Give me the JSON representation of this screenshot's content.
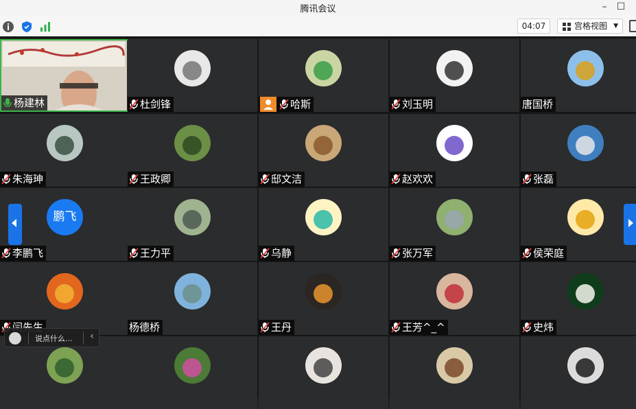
{
  "window": {
    "title": "腾讯会议"
  },
  "toolbar": {
    "icons": [
      "info-icon",
      "shield-icon",
      "signal-icon"
    ],
    "timer": "04:07",
    "view_label": "宫格视图"
  },
  "participants": [
    {
      "name": "杨建林",
      "muted": false,
      "speaking": true,
      "avatar": "video"
    },
    {
      "name": "杜剑锋",
      "muted": true,
      "avatar": "photo-gray"
    },
    {
      "name": "哈斯",
      "muted": true,
      "avatar": "photo-green",
      "badge": "user-icon"
    },
    {
      "name": "刘玉明",
      "muted": true,
      "avatar": "photo-ink"
    },
    {
      "name": "唐国桥",
      "muted": false,
      "avatar": "photo-tree"
    },
    {
      "name": "朱海珅",
      "muted": true,
      "avatar": "photo-soldiers"
    },
    {
      "name": "王政卿",
      "muted": true,
      "avatar": "photo-forest"
    },
    {
      "name": "邸文洁",
      "muted": true,
      "avatar": "photo-lion"
    },
    {
      "name": "赵欢欢",
      "muted": true,
      "avatar": "photo-cartoon"
    },
    {
      "name": "张磊",
      "muted": true,
      "avatar": "photo-coast"
    },
    {
      "name": "李鹏飞",
      "muted": true,
      "avatar": "text",
      "avatar_text": "鹏飞"
    },
    {
      "name": "王力平",
      "muted": true,
      "avatar": "photo-road"
    },
    {
      "name": "乌静",
      "muted": true,
      "avatar": "photo-kid"
    },
    {
      "name": "张万军",
      "muted": true,
      "avatar": "photo-park"
    },
    {
      "name": "侯荣庭",
      "muted": true,
      "avatar": "photo-bear"
    },
    {
      "name": "闫先生",
      "muted": true,
      "avatar": "photo-orange"
    },
    {
      "name": "杨德桥",
      "muted": false,
      "avatar": "photo-statue"
    },
    {
      "name": "王丹",
      "muted": true,
      "avatar": "photo-sunset"
    },
    {
      "name": "王芳^_^",
      "muted": true,
      "avatar": "photo-woman"
    },
    {
      "name": "史炜",
      "muted": true,
      "avatar": "photo-flower"
    },
    {
      "name": "",
      "muted": true,
      "avatar": "photo-lotus"
    },
    {
      "name": "",
      "muted": true,
      "avatar": "photo-pink"
    },
    {
      "name": "",
      "muted": true,
      "avatar": "photo-man"
    },
    {
      "name": "",
      "muted": true,
      "avatar": "photo-horse"
    },
    {
      "name": "",
      "muted": true,
      "avatar": "photo-moon"
    }
  ],
  "chat": {
    "placeholder": "说点什么..."
  },
  "colors": {
    "accent": "#1a74e8",
    "speaking": "#3ab54a",
    "badge": "#f08c2a",
    "tile_bg": "#2b2c2e"
  }
}
